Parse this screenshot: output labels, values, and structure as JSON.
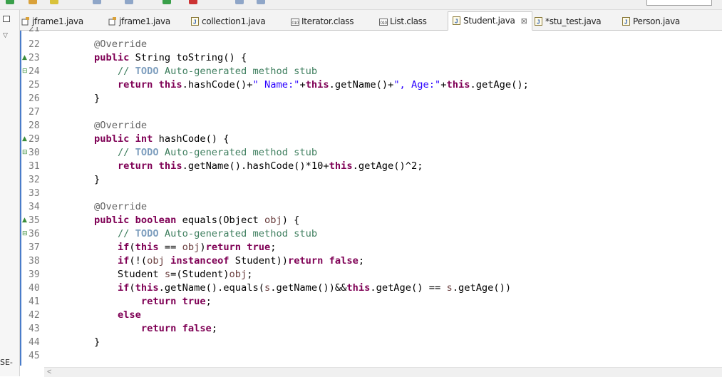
{
  "window": {
    "side_panel_label": "SE-"
  },
  "tabs": [
    {
      "label": "jframe1.java",
      "icon": "java-file-icon",
      "active": false
    },
    {
      "label": "jframe1.java",
      "icon": "java-file-icon",
      "active": false
    },
    {
      "label": "collection1.java",
      "icon": "java-source-icon",
      "active": false
    },
    {
      "label": "Iterator.class",
      "icon": "class-file-icon",
      "active": false
    },
    {
      "label": "List.class",
      "icon": "class-file-icon",
      "active": false
    },
    {
      "label": "Student.java",
      "icon": "java-source-icon",
      "active": true
    },
    {
      "label": "*stu_test.java",
      "icon": "java-source-icon",
      "active": false
    },
    {
      "label": "Person.java",
      "icon": "java-source-icon",
      "active": false
    }
  ],
  "close_glyph": "⊠",
  "editor": {
    "lines": [
      {
        "n": "22",
        "marker": "",
        "code": [
          {
            "t": "    "
          },
          {
            "t": "@Override",
            "c": "ann"
          }
        ]
      },
      {
        "n": "23",
        "marker": "ov",
        "code": [
          {
            "t": "    "
          },
          {
            "t": "public",
            "c": "kw"
          },
          {
            "t": " String toString() {"
          }
        ]
      },
      {
        "n": "24",
        "marker": "fold",
        "code": [
          {
            "t": "        "
          },
          {
            "t": "// ",
            "c": "cm"
          },
          {
            "t": "TODO",
            "c": "todo"
          },
          {
            "t": " Auto-generated method stub",
            "c": "cm"
          }
        ]
      },
      {
        "n": "25",
        "marker": "",
        "code": [
          {
            "t": "        "
          },
          {
            "t": "return",
            "c": "kw"
          },
          {
            "t": " "
          },
          {
            "t": "this",
            "c": "kw"
          },
          {
            "t": ".hashCode()+"
          },
          {
            "t": "\" Name:\"",
            "c": "str"
          },
          {
            "t": "+"
          },
          {
            "t": "this",
            "c": "kw"
          },
          {
            "t": ".getName()+"
          },
          {
            "t": "\", Age:\"",
            "c": "str"
          },
          {
            "t": "+"
          },
          {
            "t": "this",
            "c": "kw"
          },
          {
            "t": ".getAge();"
          }
        ]
      },
      {
        "n": "26",
        "marker": "",
        "code": [
          {
            "t": "    }"
          }
        ]
      },
      {
        "n": "27",
        "marker": "",
        "code": []
      },
      {
        "n": "28",
        "marker": "",
        "code": [
          {
            "t": "    "
          },
          {
            "t": "@Override",
            "c": "ann"
          }
        ]
      },
      {
        "n": "29",
        "marker": "ov",
        "code": [
          {
            "t": "    "
          },
          {
            "t": "public",
            "c": "kw"
          },
          {
            "t": " "
          },
          {
            "t": "int",
            "c": "kw"
          },
          {
            "t": " hashCode() {"
          }
        ]
      },
      {
        "n": "30",
        "marker": "fold",
        "code": [
          {
            "t": "        "
          },
          {
            "t": "// ",
            "c": "cm"
          },
          {
            "t": "TODO",
            "c": "todo"
          },
          {
            "t": " Auto-generated method stub",
            "c": "cm"
          }
        ]
      },
      {
        "n": "31",
        "marker": "",
        "code": [
          {
            "t": "        "
          },
          {
            "t": "return",
            "c": "kw"
          },
          {
            "t": " "
          },
          {
            "t": "this",
            "c": "kw"
          },
          {
            "t": ".getName().hashCode()*10+"
          },
          {
            "t": "this",
            "c": "kw"
          },
          {
            "t": ".getAge()^2;"
          }
        ]
      },
      {
        "n": "32",
        "marker": "",
        "code": [
          {
            "t": "    }"
          }
        ]
      },
      {
        "n": "33",
        "marker": "",
        "code": []
      },
      {
        "n": "34",
        "marker": "",
        "code": [
          {
            "t": "    "
          },
          {
            "t": "@Override",
            "c": "ann"
          }
        ]
      },
      {
        "n": "35",
        "marker": "ov",
        "code": [
          {
            "t": "    "
          },
          {
            "t": "public",
            "c": "kw"
          },
          {
            "t": " "
          },
          {
            "t": "boolean",
            "c": "kw"
          },
          {
            "t": " equals(Object "
          },
          {
            "t": "obj",
            "c": "var"
          },
          {
            "t": ") {"
          }
        ]
      },
      {
        "n": "36",
        "marker": "fold",
        "code": [
          {
            "t": "        "
          },
          {
            "t": "// ",
            "c": "cm"
          },
          {
            "t": "TODO",
            "c": "todo"
          },
          {
            "t": " Auto-generated method stub",
            "c": "cm"
          }
        ]
      },
      {
        "n": "37",
        "marker": "",
        "code": [
          {
            "t": "        "
          },
          {
            "t": "if",
            "c": "kw"
          },
          {
            "t": "("
          },
          {
            "t": "this",
            "c": "kw"
          },
          {
            "t": " == "
          },
          {
            "t": "obj",
            "c": "var"
          },
          {
            "t": ")"
          },
          {
            "t": "return",
            "c": "kw"
          },
          {
            "t": " "
          },
          {
            "t": "true",
            "c": "kw"
          },
          {
            "t": ";"
          }
        ]
      },
      {
        "n": "38",
        "marker": "",
        "code": [
          {
            "t": "        "
          },
          {
            "t": "if",
            "c": "kw"
          },
          {
            "t": "(!("
          },
          {
            "t": "obj",
            "c": "var"
          },
          {
            "t": " "
          },
          {
            "t": "instanceof",
            "c": "kw"
          },
          {
            "t": " Student))"
          },
          {
            "t": "return",
            "c": "kw"
          },
          {
            "t": " "
          },
          {
            "t": "false",
            "c": "kw"
          },
          {
            "t": ";"
          }
        ]
      },
      {
        "n": "39",
        "marker": "",
        "code": [
          {
            "t": "        Student "
          },
          {
            "t": "s",
            "c": "var"
          },
          {
            "t": "=(Student)"
          },
          {
            "t": "obj",
            "c": "var"
          },
          {
            "t": ";"
          }
        ]
      },
      {
        "n": "40",
        "marker": "",
        "code": [
          {
            "t": "        "
          },
          {
            "t": "if",
            "c": "kw"
          },
          {
            "t": "("
          },
          {
            "t": "this",
            "c": "kw"
          },
          {
            "t": ".getName().equals("
          },
          {
            "t": "s",
            "c": "var"
          },
          {
            "t": ".getName())&&"
          },
          {
            "t": "this",
            "c": "kw"
          },
          {
            "t": ".getAge() == "
          },
          {
            "t": "s",
            "c": "var"
          },
          {
            "t": ".getAge())"
          }
        ]
      },
      {
        "n": "41",
        "marker": "",
        "code": [
          {
            "t": "            "
          },
          {
            "t": "return",
            "c": "kw"
          },
          {
            "t": " "
          },
          {
            "t": "true",
            "c": "kw"
          },
          {
            "t": ";"
          }
        ]
      },
      {
        "n": "42",
        "marker": "",
        "code": [
          {
            "t": "        "
          },
          {
            "t": "else",
            "c": "kw"
          }
        ]
      },
      {
        "n": "43",
        "marker": "",
        "code": [
          {
            "t": "            "
          },
          {
            "t": "return",
            "c": "kw"
          },
          {
            "t": " "
          },
          {
            "t": "false",
            "c": "kw"
          },
          {
            "t": ";"
          }
        ]
      },
      {
        "n": "44",
        "marker": "",
        "code": [
          {
            "t": "    }"
          }
        ]
      },
      {
        "n": "45",
        "marker": "",
        "code": []
      }
    ],
    "partial_top_line_number": "21"
  },
  "scrollbar": {
    "left_arrow": "<"
  },
  "colors": {
    "keyword": "#7f0055",
    "annotation": "#646464",
    "comment": "#3f7f5f",
    "todo": "#7f9fbf",
    "string": "#2a00ff",
    "local_var": "#6a3e3e",
    "line_number": "#7a7a7a",
    "ruler": "#4a7cc9"
  }
}
